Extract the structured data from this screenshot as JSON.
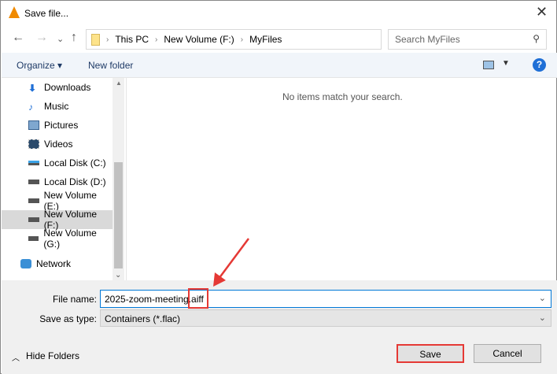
{
  "window": {
    "title": "Save file...",
    "close": "✕"
  },
  "nav": {
    "back": "←",
    "forward": "→",
    "recent": "⌄",
    "up": "↑",
    "breadcrumb": [
      "This PC",
      "New Volume (F:)",
      "MyFiles"
    ],
    "search_placeholder": "Search MyFiles"
  },
  "toolbar": {
    "organize": "Organize ▾",
    "new_folder": "New folder",
    "help": "?"
  },
  "sidebar": {
    "items": [
      {
        "label": "Downloads",
        "icon": "download-icon"
      },
      {
        "label": "Music",
        "icon": "music-icon"
      },
      {
        "label": "Pictures",
        "icon": "pictures-icon"
      },
      {
        "label": "Videos",
        "icon": "videos-icon"
      },
      {
        "label": "Local Disk (C:)",
        "icon": "drive-icon"
      },
      {
        "label": "Local Disk (D:)",
        "icon": "drive-icon"
      },
      {
        "label": "New Volume (E:)",
        "icon": "drive-icon"
      },
      {
        "label": "New Volume (F:)",
        "icon": "drive-icon",
        "selected": true
      },
      {
        "label": "New Volume (G:)",
        "icon": "drive-icon"
      }
    ],
    "network": "Network"
  },
  "main": {
    "empty_text": "No items match your search."
  },
  "form": {
    "file_name_label": "File name:",
    "file_name_value": "2025-zoom-meeting.aiff",
    "type_label": "Save as type:",
    "type_value": "Containers (*.flac)"
  },
  "footer": {
    "hide_folders": "Hide Folders",
    "save": "Save",
    "cancel": "Cancel"
  },
  "colors": {
    "highlight": "#e53935",
    "accent": "#0078d7"
  }
}
